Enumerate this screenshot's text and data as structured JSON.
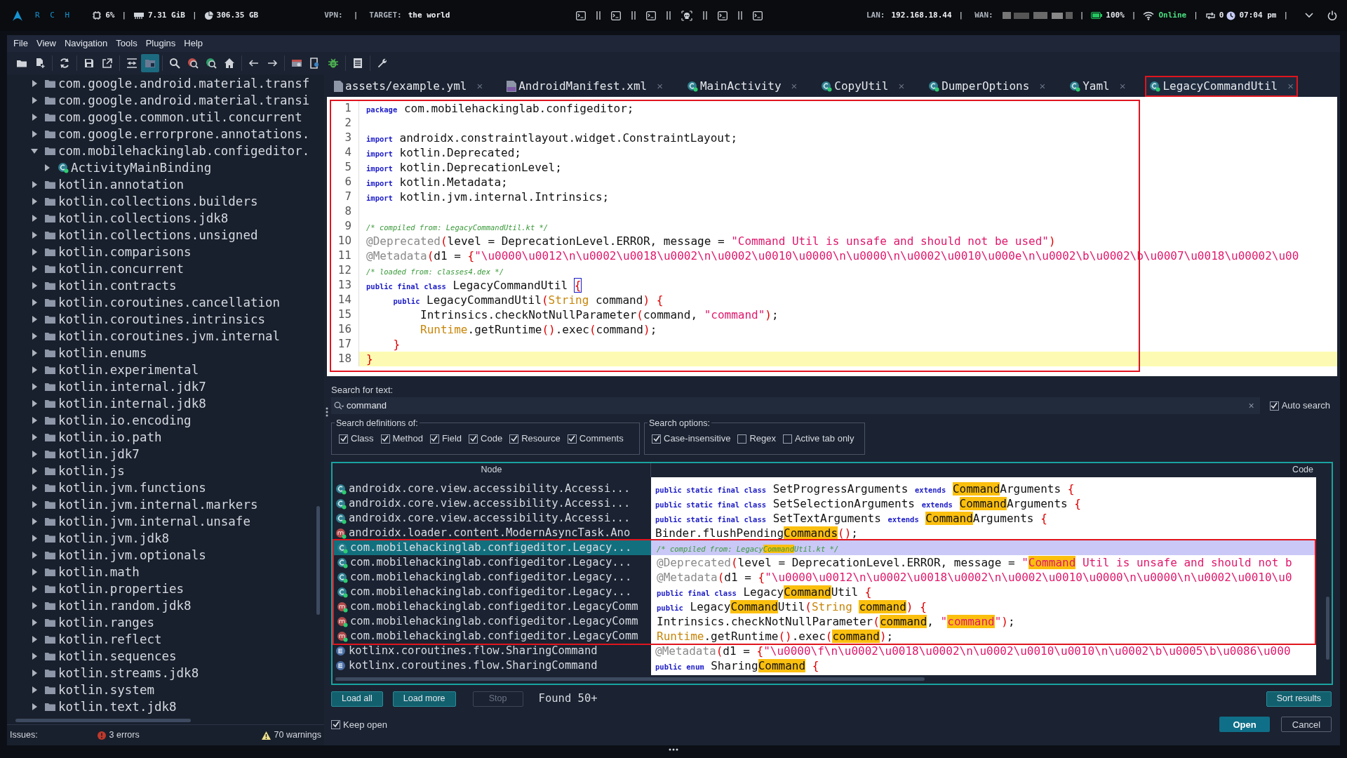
{
  "system_bar": {
    "left": [
      {
        "kind": "logo",
        "text": "R C H"
      },
      {
        "kind": "cpu",
        "text": "6%"
      },
      {
        "kind": "sep",
        "text": "|"
      },
      {
        "kind": "ram",
        "text": "7.31 GiB"
      },
      {
        "kind": "sep",
        "text": "|"
      },
      {
        "kind": "disk",
        "text": "306.35 GB"
      },
      {
        "kind": "label",
        "text": "VPN:"
      },
      {
        "kind": "sep",
        "text": "|"
      },
      {
        "kind": "label",
        "text": "TARGET:"
      },
      {
        "kind": "value",
        "text": "the world"
      }
    ],
    "center": [
      {
        "kind": "term"
      },
      {
        "kind": "pause"
      },
      {
        "kind": "term"
      },
      {
        "kind": "pause"
      },
      {
        "kind": "term"
      },
      {
        "kind": "pause"
      },
      {
        "kind": "skull"
      },
      {
        "kind": "pause"
      },
      {
        "kind": "term"
      },
      {
        "kind": "pause"
      },
      {
        "kind": "term"
      }
    ],
    "right": [
      {
        "kind": "label",
        "text": "LAN:"
      },
      {
        "kind": "value",
        "text": "192.168.18.44"
      },
      {
        "kind": "sep",
        "text": "|"
      },
      {
        "kind": "label",
        "text": "WAN:"
      },
      {
        "kind": "redacted"
      },
      {
        "kind": "sep",
        "text": "|"
      },
      {
        "kind": "battery",
        "text": "100%"
      },
      {
        "kind": "sep",
        "text": "|"
      },
      {
        "kind": "wifi",
        "text": "Online"
      },
      {
        "kind": "sep",
        "text": "|"
      },
      {
        "kind": "sync",
        "text": "0"
      },
      {
        "kind": "clock",
        "text": "07:04 pm"
      },
      {
        "kind": "sep",
        "text": "|"
      },
      {
        "kind": "chevron"
      },
      {
        "kind": "power"
      }
    ]
  },
  "menu": [
    "File",
    "View",
    "Navigation",
    "Tools",
    "Plugins",
    "Help"
  ],
  "toolbar": [
    [
      {
        "kind": "open",
        "selected": false
      },
      {
        "kind": "add",
        "selected": false
      }
    ],
    [
      {
        "kind": "reload",
        "selected": false
      }
    ],
    [
      {
        "kind": "save",
        "selected": false
      },
      {
        "kind": "export",
        "selected": false
      }
    ],
    [
      {
        "kind": "wrap",
        "selected": false
      },
      {
        "kind": "sync-tree",
        "selected": true
      }
    ],
    [
      {
        "kind": "search",
        "selected": false
      },
      {
        "kind": "search-class",
        "selected": false
      },
      {
        "kind": "search-usage",
        "selected": false
      },
      {
        "kind": "home",
        "selected": false
      }
    ],
    [
      {
        "kind": "back",
        "selected": false
      },
      {
        "kind": "forward",
        "selected": false
      }
    ],
    [
      {
        "kind": "deobf",
        "selected": false
      },
      {
        "kind": "quark",
        "selected": false
      },
      {
        "kind": "debug",
        "selected": false
      }
    ],
    [
      {
        "kind": "log",
        "selected": false
      }
    ],
    [
      {
        "kind": "prefs",
        "selected": false
      }
    ]
  ],
  "tree": [
    {
      "kind": "package",
      "label": "com.google.android.material.transf",
      "expanded": false
    },
    {
      "kind": "package",
      "label": "com.google.android.material.transi",
      "expanded": false
    },
    {
      "kind": "package",
      "label": "com.google.common.util.concurrent",
      "expanded": false
    },
    {
      "kind": "package",
      "label": "com.google.errorprone.annotations.",
      "expanded": false
    },
    {
      "kind": "package",
      "label": "com.mobilehackinglab.configeditor.",
      "expanded": true,
      "children": [
        {
          "kind": "class",
          "label": "ActivityMainBinding",
          "expanded": false
        }
      ]
    },
    {
      "kind": "package",
      "label": "kotlin.annotation",
      "expanded": false
    },
    {
      "kind": "package",
      "label": "kotlin.collections.builders",
      "expanded": false
    },
    {
      "kind": "package",
      "label": "kotlin.collections.jdk8",
      "expanded": false
    },
    {
      "kind": "package",
      "label": "kotlin.collections.unsigned",
      "expanded": false
    },
    {
      "kind": "package",
      "label": "kotlin.comparisons",
      "expanded": false
    },
    {
      "kind": "package",
      "label": "kotlin.concurrent",
      "expanded": false
    },
    {
      "kind": "package",
      "label": "kotlin.contracts",
      "expanded": false
    },
    {
      "kind": "package",
      "label": "kotlin.coroutines.cancellation",
      "expanded": false
    },
    {
      "kind": "package",
      "label": "kotlin.coroutines.intrinsics",
      "expanded": false
    },
    {
      "kind": "package",
      "label": "kotlin.coroutines.jvm.internal",
      "expanded": false
    },
    {
      "kind": "package",
      "label": "kotlin.enums",
      "expanded": false
    },
    {
      "kind": "package",
      "label": "kotlin.experimental",
      "expanded": false
    },
    {
      "kind": "package",
      "label": "kotlin.internal.jdk7",
      "expanded": false
    },
    {
      "kind": "package",
      "label": "kotlin.internal.jdk8",
      "expanded": false
    },
    {
      "kind": "package",
      "label": "kotlin.io.encoding",
      "expanded": false
    },
    {
      "kind": "package",
      "label": "kotlin.io.path",
      "expanded": false
    },
    {
      "kind": "package",
      "label": "kotlin.jdk7",
      "expanded": false
    },
    {
      "kind": "package",
      "label": "kotlin.js",
      "expanded": false
    },
    {
      "kind": "package",
      "label": "kotlin.jvm.functions",
      "expanded": false
    },
    {
      "kind": "package",
      "label": "kotlin.jvm.internal.markers",
      "expanded": false
    },
    {
      "kind": "package",
      "label": "kotlin.jvm.internal.unsafe",
      "expanded": false
    },
    {
      "kind": "package",
      "label": "kotlin.jvm.jdk8",
      "expanded": false
    },
    {
      "kind": "package",
      "label": "kotlin.jvm.optionals",
      "expanded": false
    },
    {
      "kind": "package",
      "label": "kotlin.math",
      "expanded": false
    },
    {
      "kind": "package",
      "label": "kotlin.properties",
      "expanded": false
    },
    {
      "kind": "package",
      "label": "kotlin.random.jdk8",
      "expanded": false
    },
    {
      "kind": "package",
      "label": "kotlin.ranges",
      "expanded": false
    },
    {
      "kind": "package",
      "label": "kotlin.reflect",
      "expanded": false
    },
    {
      "kind": "package",
      "label": "kotlin.sequences",
      "expanded": false
    },
    {
      "kind": "package",
      "label": "kotlin.streams.jdk8",
      "expanded": false
    },
    {
      "kind": "package",
      "label": "kotlin.system",
      "expanded": false
    },
    {
      "kind": "package",
      "label": "kotlin.text.jdk8",
      "expanded": false
    }
  ],
  "issues": {
    "label": "Issues:",
    "errors": "3 errors",
    "warnings": "70 warnings"
  },
  "tabs": [
    {
      "kind": "yaml",
      "label": "assets/example.yml",
      "close": "×",
      "selected": false,
      "outlined": false
    },
    {
      "kind": "manifest",
      "label": "AndroidManifest.xml",
      "close": "×",
      "selected": false,
      "outlined": false
    },
    {
      "kind": "class",
      "label": "MainActivity",
      "close": "×",
      "selected": false,
      "outlined": false
    },
    {
      "kind": "class",
      "label": "CopyUtil",
      "close": "×",
      "selected": false,
      "outlined": false
    },
    {
      "kind": "class",
      "label": "DumperOptions",
      "close": "×",
      "selected": false,
      "outlined": false
    },
    {
      "kind": "class",
      "label": "Yaml",
      "close": "×",
      "selected": false,
      "outlined": false
    },
    {
      "kind": "class",
      "label": "LegacyCommandUtil",
      "close": "×",
      "selected": true,
      "outlined": true
    }
  ],
  "editor": {
    "outlined": true,
    "lines": [
      {
        "number": "1",
        "current": false,
        "segments": [
          {
            "kind": "kw",
            "text": "package"
          },
          {
            "kind": "plain",
            "text": " com.mobilehackinglab.configeditor;"
          }
        ]
      },
      {
        "number": "2",
        "current": false
      },
      {
        "number": "3",
        "current": false,
        "segments": [
          {
            "kind": "kw",
            "text": "import"
          },
          {
            "kind": "plain",
            "text": " androidx.constraintlayout.widget.ConstraintLayout;"
          }
        ]
      },
      {
        "number": "4",
        "current": false,
        "segments": [
          {
            "kind": "kw",
            "text": "import"
          },
          {
            "kind": "plain",
            "text": " kotlin.Deprecated;"
          }
        ]
      },
      {
        "number": "5",
        "current": false,
        "segments": [
          {
            "kind": "kw",
            "text": "import"
          },
          {
            "kind": "plain",
            "text": " kotlin.DeprecationLevel;"
          }
        ]
      },
      {
        "number": "6",
        "current": false,
        "segments": [
          {
            "kind": "kw",
            "text": "import"
          },
          {
            "kind": "plain",
            "text": " kotlin.Metadata;"
          }
        ]
      },
      {
        "number": "7",
        "current": false,
        "segments": [
          {
            "kind": "kw",
            "text": "import"
          },
          {
            "kind": "plain",
            "text": " kotlin.jvm.internal.Intrinsics;"
          }
        ]
      },
      {
        "number": "8",
        "current": false
      },
      {
        "number": "9",
        "current": false,
        "segments": [
          {
            "kind": "comment",
            "text": "/* compiled from: LegacyCommandUtil.kt */"
          }
        ]
      },
      {
        "number": "10",
        "current": false,
        "segments": [
          {
            "kind": "anno",
            "text": "@Deprecated"
          },
          {
            "kind": "punct",
            "text": "("
          },
          {
            "kind": "plain",
            "text": "level = DeprecationLevel.ERROR, message = "
          },
          {
            "kind": "str",
            "text": "\"Command Util is unsafe and should not be used\""
          },
          {
            "kind": "punct",
            "text": ")"
          }
        ]
      },
      {
        "number": "11",
        "current": false,
        "segments": [
          {
            "kind": "anno",
            "text": "@Metadata"
          },
          {
            "kind": "punct",
            "text": "("
          },
          {
            "kind": "plain",
            "text": "d1 = "
          },
          {
            "kind": "punct",
            "text": "{"
          },
          {
            "kind": "str",
            "text": "\"\\u0000\\u0012\\n\\u0002\\u0018\\u0002\\n\\u0002\\u0010\\u0000\\n\\u0000\\n\\u0002\\u0010\\u000e\\n\\u0002\\b\\u0002\\b\\u0007\\u0018\\u00002\\u00"
          }
        ]
      },
      {
        "number": "12",
        "current": false,
        "segments": [
          {
            "kind": "comment",
            "text": "/* loaded from: classes4.dex */"
          }
        ]
      },
      {
        "number": "13",
        "current": false,
        "segments": [
          {
            "kind": "kw",
            "text": "public final class"
          },
          {
            "kind": "plain",
            "text": " LegacyCommandUtil "
          },
          {
            "kind": "brace",
            "text": "{"
          }
        ]
      },
      {
        "number": "14",
        "current": false,
        "segments": [
          {
            "kind": "kw",
            "text": "    public"
          },
          {
            "kind": "plain",
            "text": " LegacyCommandUtil"
          },
          {
            "kind": "punct",
            "text": "("
          },
          {
            "kind": "type",
            "text": "String"
          },
          {
            "kind": "plain",
            "text": " command"
          },
          {
            "kind": "punct",
            "text": ") {"
          }
        ]
      },
      {
        "number": "15",
        "current": false,
        "segments": [
          {
            "kind": "plain",
            "text": "        Intrinsics.checkNotNullParameter"
          },
          {
            "kind": "punct",
            "text": "("
          },
          {
            "kind": "plain",
            "text": "command, "
          },
          {
            "kind": "str",
            "text": "\"command\""
          },
          {
            "kind": "punct",
            "text": ")"
          },
          {
            "kind": "plain",
            "text": ";"
          }
        ]
      },
      {
        "number": "16",
        "current": false,
        "segments": [
          {
            "kind": "type",
            "text": "        Runtime"
          },
          {
            "kind": "plain",
            "text": ".getRuntime"
          },
          {
            "kind": "punct",
            "text": "()"
          },
          {
            "kind": "plain",
            "text": ".exec"
          },
          {
            "kind": "punct",
            "text": "("
          },
          {
            "kind": "plain",
            "text": "command"
          },
          {
            "kind": "punct",
            "text": ")"
          },
          {
            "kind": "plain",
            "text": ";"
          }
        ]
      },
      {
        "number": "17",
        "current": false,
        "segments": [
          {
            "kind": "punct",
            "text": "    }"
          }
        ]
      },
      {
        "number": "18",
        "current": true,
        "segments": [
          {
            "kind": "punct",
            "text": "}"
          }
        ]
      }
    ]
  },
  "search": {
    "label": "Search for text:",
    "field": {
      "value": "command",
      "clear": "×"
    },
    "auto_search": {
      "label": "Auto search",
      "checked": true
    },
    "definitions": {
      "title": "Search definitions of:",
      "options": [
        {
          "label": "Class",
          "checked": true
        },
        {
          "label": "Method",
          "checked": true
        },
        {
          "label": "Field",
          "checked": true
        },
        {
          "label": "Code",
          "checked": true
        },
        {
          "label": "Resource",
          "checked": true
        },
        {
          "label": "Comments",
          "checked": true
        }
      ]
    },
    "options": {
      "title": "Search options:",
      "options": [
        {
          "label": "Case-insensitive",
          "checked": true
        },
        {
          "label": "Regex",
          "checked": false
        },
        {
          "label": "Active tab only",
          "checked": false
        }
      ]
    }
  },
  "results": {
    "columns": [
      "Node",
      "Code"
    ],
    "groups": [
      {
        "outlined": false,
        "rows": [
          {
            "kind": "class",
            "node": "androidx.core.view.accessibility.Accessi...",
            "selected": false,
            "code": [
              {
                "kind": "kw",
                "text": "public static final class"
              },
              {
                "kind": "plain",
                "text": " SetProgressArguments "
              },
              {
                "kind": "kw",
                "text": "extends "
              },
              {
                "kind": "match",
                "text": "Command"
              },
              {
                "kind": "plain",
                "text": "Arguments "
              },
              {
                "kind": "punct",
                "text": "{"
              }
            ]
          },
          {
            "kind": "class",
            "node": "androidx.core.view.accessibility.Accessi...",
            "selected": false,
            "code": [
              {
                "kind": "kw",
                "text": "public static final class"
              },
              {
                "kind": "plain",
                "text": " SetSelectionArguments "
              },
              {
                "kind": "kw",
                "text": "extends "
              },
              {
                "kind": "match",
                "text": "Command"
              },
              {
                "kind": "plain",
                "text": "Arguments "
              },
              {
                "kind": "punct",
                "text": "{"
              }
            ]
          },
          {
            "kind": "class",
            "node": "androidx.core.view.accessibility.Accessi...",
            "selected": false,
            "code": [
              {
                "kind": "kw",
                "text": "public static final class"
              },
              {
                "kind": "plain",
                "text": " SetTextArguments "
              },
              {
                "kind": "kw",
                "text": "extends "
              },
              {
                "kind": "match",
                "text": "Command"
              },
              {
                "kind": "plain",
                "text": "Arguments "
              },
              {
                "kind": "punct",
                "text": "{"
              }
            ]
          },
          {
            "kind": "method",
            "node": "androidx.loader.content.ModernAsyncTask.Ano",
            "selected": false,
            "code": [
              {
                "kind": "plain",
                "text": "Binder.flushPending"
              },
              {
                "kind": "match",
                "text": "Commands"
              },
              {
                "kind": "punct",
                "text": "()"
              },
              {
                "kind": "plain",
                "text": ";"
              }
            ]
          }
        ]
      },
      {
        "outlined": true,
        "rows": [
          {
            "kind": "class",
            "node": "com.mobilehackinglab.configeditor.Legacy...",
            "selected": true,
            "code": [
              {
                "kind": "comment",
                "text": "/* compiled from: Legacy"
              },
              {
                "kind": "match_comment",
                "text": "Command"
              },
              {
                "kind": "comment",
                "text": "Util.kt */"
              }
            ]
          },
          {
            "kind": "class",
            "node": "com.mobilehackinglab.configeditor.Legacy...",
            "selected": false,
            "code": [
              {
                "kind": "anno",
                "text": "@Deprecated"
              },
              {
                "kind": "punct",
                "text": "("
              },
              {
                "kind": "plain",
                "text": "level = DeprecationLevel.ERROR, message = "
              },
              {
                "kind": "str",
                "text": "\""
              },
              {
                "kind": "match_str",
                "text": "Command"
              },
              {
                "kind": "str",
                "text": " Util is unsafe and should not b"
              }
            ]
          },
          {
            "kind": "class",
            "node": "com.mobilehackinglab.configeditor.Legacy...",
            "selected": false,
            "code": [
              {
                "kind": "anno",
                "text": "@Metadata"
              },
              {
                "kind": "punct",
                "text": "("
              },
              {
                "kind": "plain",
                "text": "d1 = "
              },
              {
                "kind": "punct",
                "text": "{"
              },
              {
                "kind": "str",
                "text": "\"\\u0000\\u0012\\n\\u0002\\u0018\\u0002\\n\\u0002\\u0010\\u0000\\n\\u0000\\n\\u0002\\u0010\\u0"
              }
            ]
          },
          {
            "kind": "class",
            "node": "com.mobilehackinglab.configeditor.Legacy...",
            "selected": false,
            "code": [
              {
                "kind": "kw",
                "text": "public final class"
              },
              {
                "kind": "plain",
                "text": " Legacy"
              },
              {
                "kind": "match",
                "text": "Command"
              },
              {
                "kind": "plain",
                "text": "Util "
              },
              {
                "kind": "punct",
                "text": "{"
              }
            ]
          },
          {
            "kind": "method",
            "node": "com.mobilehackinglab.configeditor.LegacyComm",
            "selected": false,
            "code": [
              {
                "kind": "kw",
                "text": "public"
              },
              {
                "kind": "plain",
                "text": " Legacy"
              },
              {
                "kind": "match",
                "text": "Command"
              },
              {
                "kind": "plain",
                "text": "Util"
              },
              {
                "kind": "punct",
                "text": "("
              },
              {
                "kind": "type",
                "text": "String "
              },
              {
                "kind": "match",
                "text": "command"
              },
              {
                "kind": "punct",
                "text": ") {"
              }
            ]
          },
          {
            "kind": "method",
            "node": "com.mobilehackinglab.configeditor.LegacyComm",
            "selected": false,
            "code": [
              {
                "kind": "plain",
                "text": "Intrinsics.checkNotNullParameter"
              },
              {
                "kind": "punct",
                "text": "("
              },
              {
                "kind": "match",
                "text": "command"
              },
              {
                "kind": "plain",
                "text": ", "
              },
              {
                "kind": "str",
                "text": "\""
              },
              {
                "kind": "match_str",
                "text": "command"
              },
              {
                "kind": "str",
                "text": "\""
              },
              {
                "kind": "punct",
                "text": ")"
              },
              {
                "kind": "plain",
                "text": ";"
              }
            ]
          },
          {
            "kind": "method",
            "node": "com.mobilehackinglab.configeditor.LegacyComm",
            "selected": false,
            "code": [
              {
                "kind": "type",
                "text": "Runtime"
              },
              {
                "kind": "plain",
                "text": ".getRuntime"
              },
              {
                "kind": "punct",
                "text": "()"
              },
              {
                "kind": "plain",
                "text": ".exec"
              },
              {
                "kind": "punct",
                "text": "("
              },
              {
                "kind": "match",
                "text": "command"
              },
              {
                "kind": "punct",
                "text": ")"
              },
              {
                "kind": "plain",
                "text": ";"
              }
            ]
          }
        ]
      },
      {
        "outlined": false,
        "rows": [
          {
            "kind": "enum",
            "node": "kotlinx.coroutines.flow.SharingCommand",
            "selected": false,
            "code": [
              {
                "kind": "anno",
                "text": "@Metadata"
              },
              {
                "kind": "punct",
                "text": "("
              },
              {
                "kind": "plain",
                "text": "d1 = "
              },
              {
                "kind": "punct",
                "text": "{"
              },
              {
                "kind": "str",
                "text": "\"\\u0000\\f\\n\\u0002\\u0018\\u0002\\n\\u0002\\u0010\\u0010\\n\\u0002\\b\\u0005\\b\\u0086\\u000"
              }
            ]
          },
          {
            "kind": "enum",
            "node": "kotlinx.coroutines.flow.SharingCommand",
            "selected": false,
            "code": [
              {
                "kind": "kw",
                "text": "public enum"
              },
              {
                "kind": "plain",
                "text": " Sharing"
              },
              {
                "kind": "match",
                "text": "Command"
              },
              {
                "kind": "punct",
                "text": " {"
              }
            ]
          }
        ]
      }
    ]
  },
  "actions": {
    "load_all": "Load all",
    "load_more": "Load more",
    "stop": {
      "label": "Stop",
      "disabled": true
    },
    "found": "Found 50+",
    "sort": "Sort results"
  },
  "footer": {
    "keep_open": {
      "label": "Keep open",
      "checked": true
    },
    "open": "Open",
    "cancel": "Cancel"
  }
}
